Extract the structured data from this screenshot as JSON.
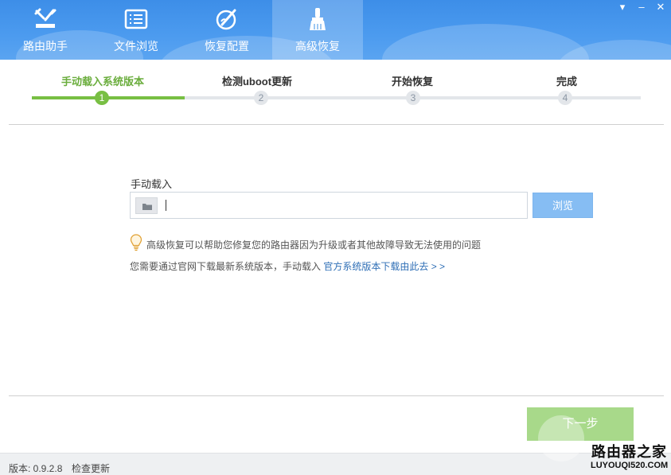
{
  "nav": {
    "items": [
      {
        "label": "路由助手",
        "icon": "router-tools-icon"
      },
      {
        "label": "文件浏览",
        "icon": "file-browser-icon"
      },
      {
        "label": "恢复配置",
        "icon": "restore-config-icon"
      },
      {
        "label": "高级恢复",
        "icon": "brush-icon",
        "active": true
      }
    ]
  },
  "window": {
    "minimize": "–",
    "close": "✕"
  },
  "steps": [
    {
      "label": "手动载入系统版本",
      "num": "1"
    },
    {
      "label": "检测uboot更新",
      "num": "2"
    },
    {
      "label": "开始恢复",
      "num": "3"
    },
    {
      "label": "完成",
      "num": "4"
    }
  ],
  "main": {
    "label": "手动载入",
    "browse_label": "浏览",
    "hint1": "高级恢复可以帮助您修复您的路由器因为升级或者其他故障导致无法使用的问题",
    "hint2": "您需要通过官网下载最新系统版本，手动载入",
    "hint_link": "官方系统版本下载由此去 > >",
    "next_label": "下一步"
  },
  "footer": {
    "version": "版本: 0.9.2.8",
    "check_update": "检查更新"
  },
  "watermark": {
    "title": "路由器之家",
    "sub": "LUYOUQI520.COM"
  },
  "colors": {
    "header": "#4c9bef",
    "active_step": "#78bf43",
    "link": "#2f6fb6",
    "next_btn": "#a8d98a",
    "browse_btn": "#86bdf3"
  }
}
